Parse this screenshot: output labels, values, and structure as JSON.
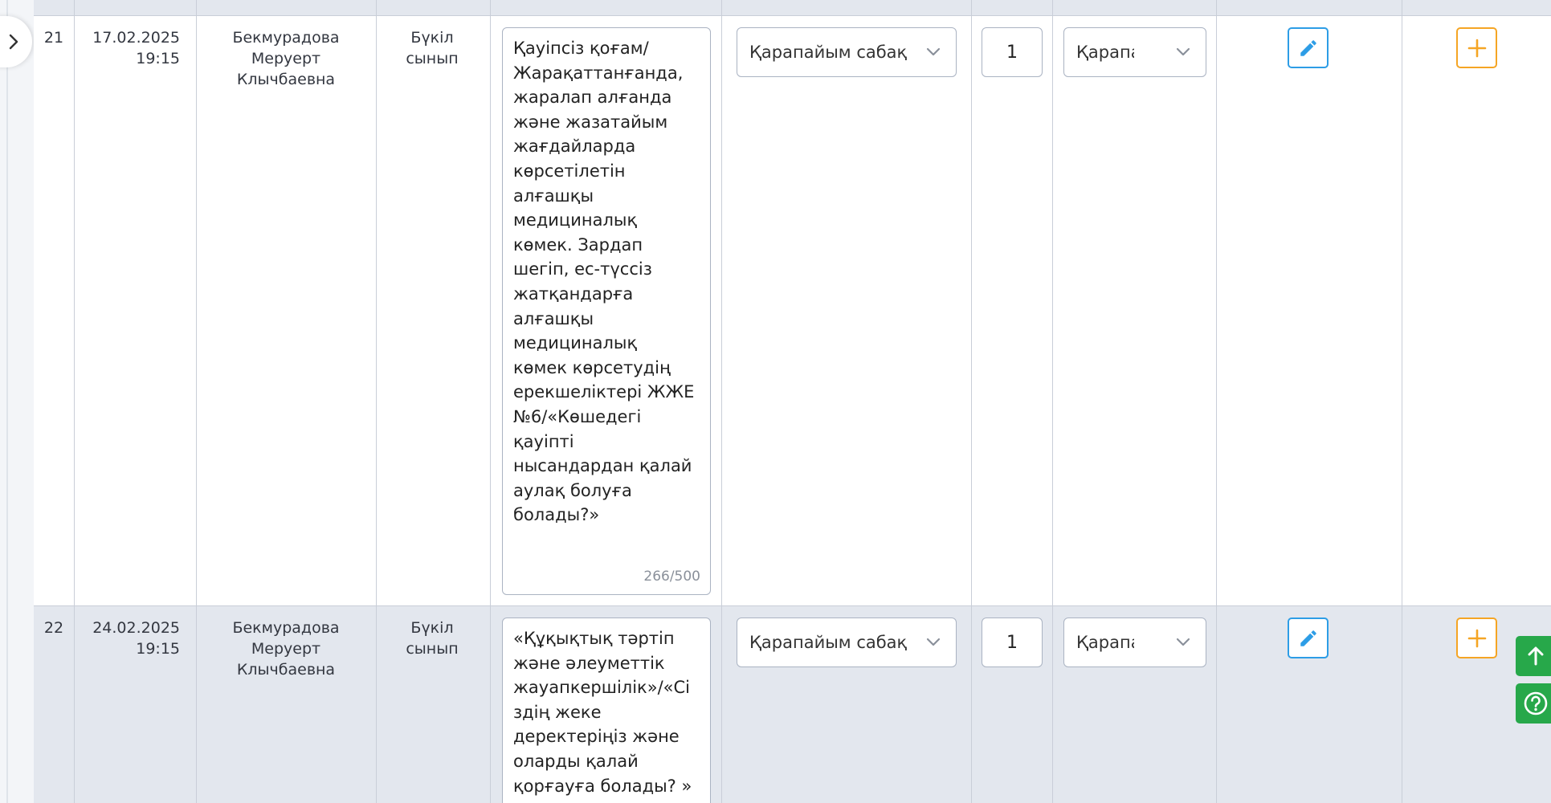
{
  "rows": [
    {
      "num": "21",
      "date": "17.02.2025",
      "time": "19:15",
      "teacher": [
        "Бекмурадова",
        "Меруерт",
        "Клычбаевна"
      ],
      "audience": [
        "Бүкіл",
        "сынып"
      ],
      "topic_lines": [
        "Қауіпсіз қоғам/",
        "Жарақаттанғанда,",
        "жаралап алғанда",
        "және жазатайым",
        "жағдайларда",
        "көрсетілетін",
        "алғашқы",
        "медициналық",
        "көмек. Зардап",
        "шегіп, ес-түссіз",
        "жатқандарға",
        "алғашқы",
        "медициналық",
        "көмек көрсетудің",
        "ерекшеліктері ЖЖЕ",
        "№6/«Көшедегі",
        "қауіпті",
        "нысандардан қалай",
        "аулақ болуға",
        "болады?»"
      ],
      "char_count": "266/500",
      "lesson_type": "Қарапайым сабақ",
      "hours": "1",
      "grade_type": "Қарапа"
    },
    {
      "num": "22",
      "date": "24.02.2025",
      "time": "19:15",
      "teacher": [
        "Бекмурадова",
        "Меруерт",
        "Клычбаевна"
      ],
      "audience": [
        "Бүкіл",
        "сынып"
      ],
      "topic_lines": [
        "«Құқықтық тәртіп",
        "және әлеуметтік",
        "жауапкершілік»/«Сі",
        "здің жеке",
        "деректеріңіз және",
        "оларды қалай",
        "қорғауға болады? »"
      ],
      "lesson_type": "Қарапайым сабақ",
      "hours": "1",
      "grade_type": "Қарапа"
    }
  ],
  "icons": {
    "sidebar_toggle": "chevron-right-icon",
    "edit": "pencil-icon",
    "add": "plus-icon",
    "scroll_top": "arrow-up-icon",
    "help": "question-circle-icon",
    "select": "chevron-down-icon"
  },
  "colors": {
    "edit_accent": "#2d9de6",
    "add_accent": "#f5a524",
    "float_button": "#27a84a",
    "alt_row": "#e3e7ee"
  }
}
